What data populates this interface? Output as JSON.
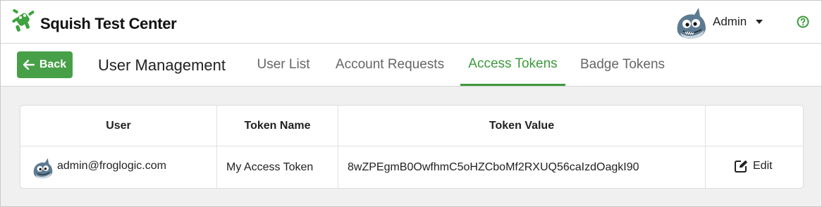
{
  "header": {
    "app_title": "Squish Test Center",
    "user_name": "Admin",
    "help_icon": "question-circle-icon"
  },
  "subheader": {
    "back_label": "Back",
    "page_title": "User Management",
    "tabs": [
      {
        "label": "User List",
        "active": false
      },
      {
        "label": "Account Requests",
        "active": false
      },
      {
        "label": "Access Tokens",
        "active": true
      },
      {
        "label": "Badge Tokens",
        "active": false
      }
    ]
  },
  "table": {
    "columns": [
      "User",
      "Token Name",
      "Token Value",
      ""
    ],
    "rows": [
      {
        "user": "admin@froglogic.com",
        "token_name": "My Access Token",
        "token_value": "8wZPEgmB0OwfhmC5oHZCboMf2RXUQ56caIzdOagkI90",
        "action": "Edit"
      }
    ]
  },
  "colors": {
    "accent": "#3d9a3d",
    "back_button": "#47a047"
  }
}
